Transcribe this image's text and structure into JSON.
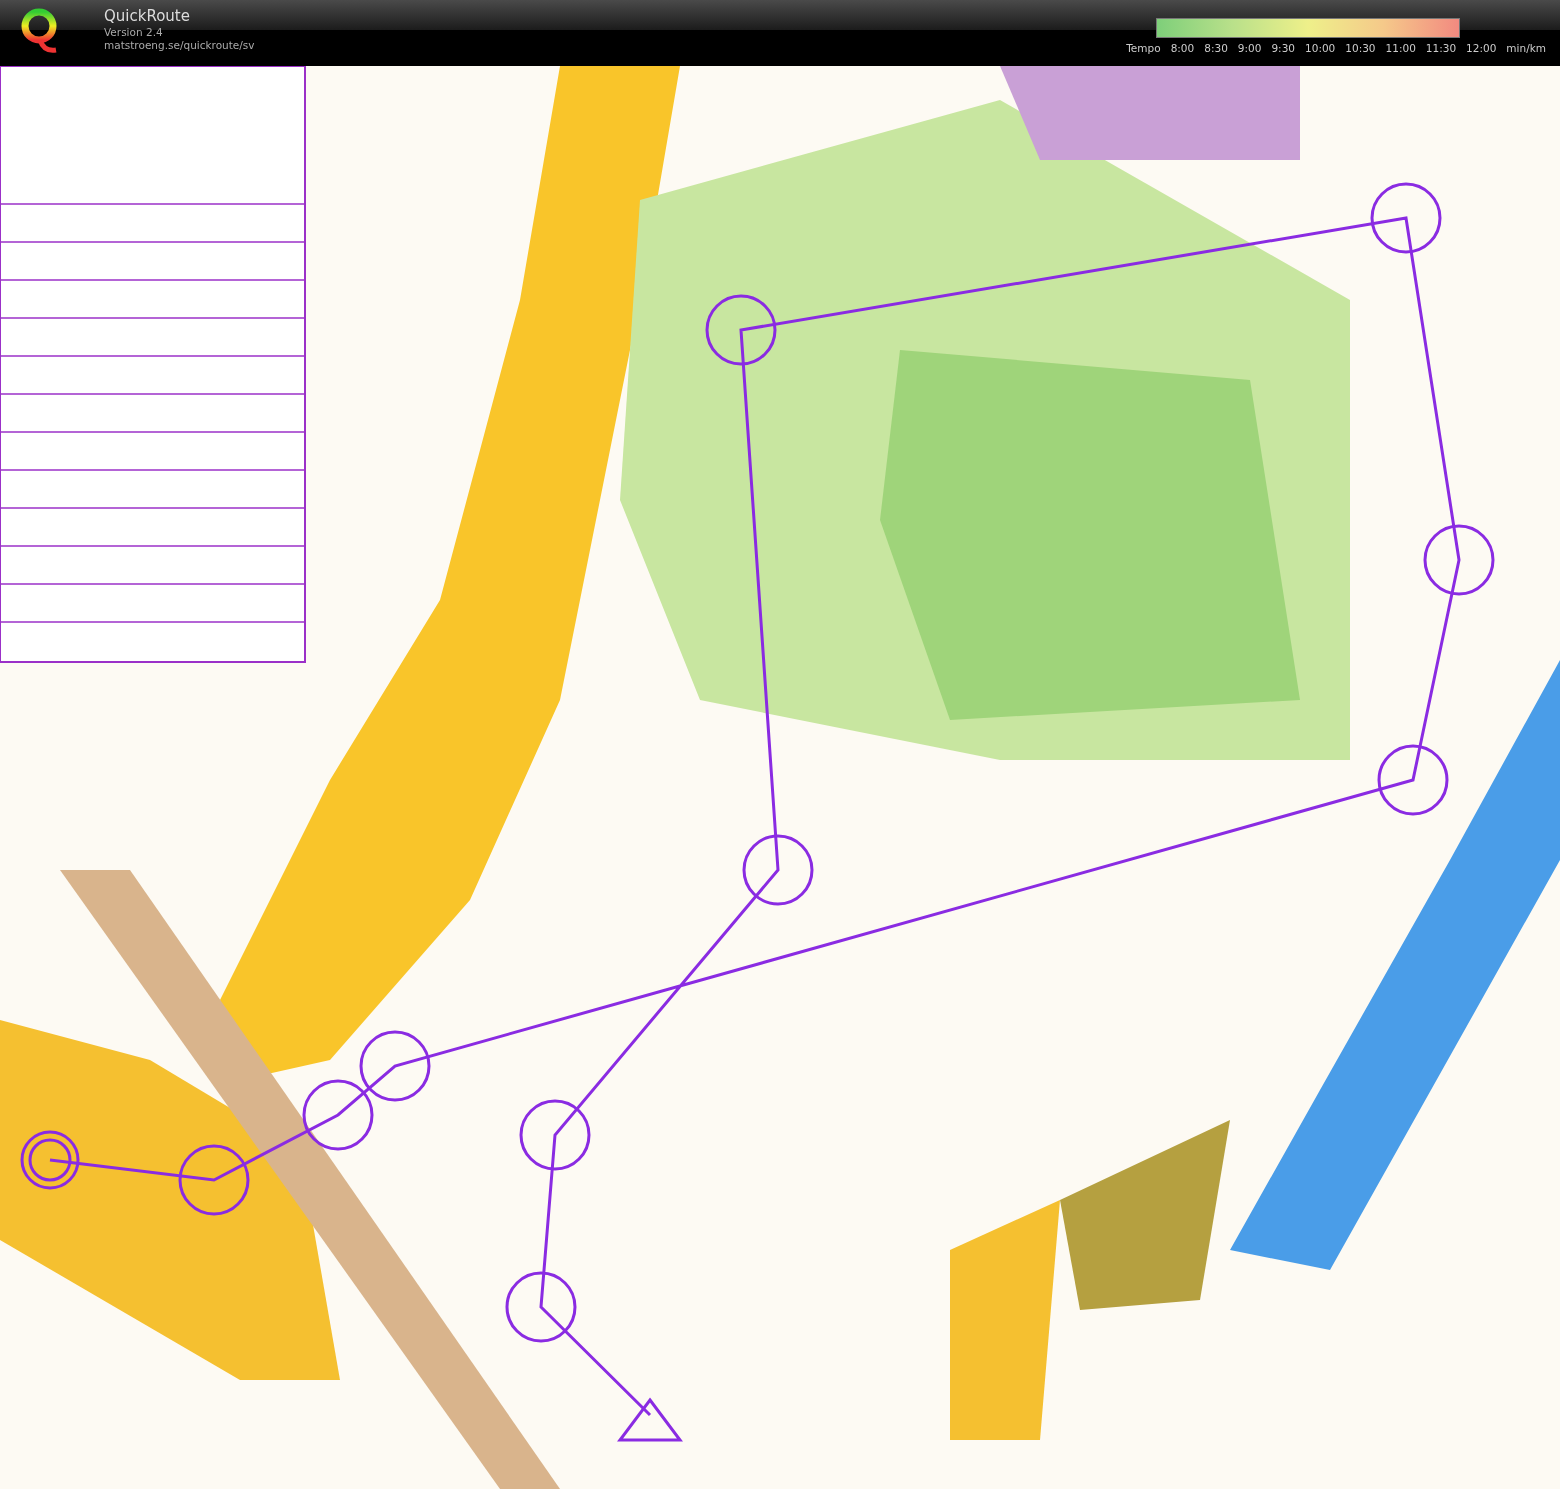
{
  "header": {
    "app_name": "QuickRoute",
    "version": "Version 2.4",
    "url": "matstroeng.se/quickroute/sv"
  },
  "legend": {
    "label": "Tempo",
    "ticks": [
      "8:00",
      "8:30",
      "9:00",
      "9:30",
      "10:00",
      "10:30",
      "11:00",
      "11:30",
      "12:00"
    ],
    "unit": "min/km"
  }
}
